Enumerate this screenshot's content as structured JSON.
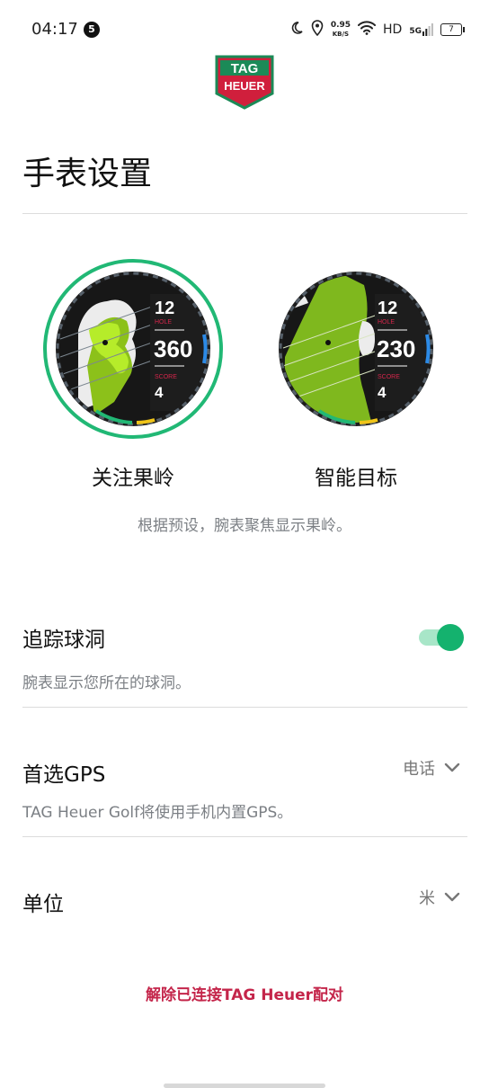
{
  "status_bar": {
    "time": "04:17",
    "notification_count": "5",
    "net_speed": "0.95",
    "net_unit": "KB/S",
    "hd": "HD",
    "network": "5G",
    "battery": "7"
  },
  "header": {
    "logo_line1": "TAG",
    "logo_line2": "HEUER",
    "title": "手表设置"
  },
  "watch_faces": [
    {
      "label": "关注果岭",
      "selected": true,
      "hole": "12",
      "hole_label": "HOLE",
      "distance": "360",
      "score_label": "SCORE",
      "score": "4"
    },
    {
      "label": "智能目标",
      "selected": false,
      "hole": "12",
      "hole_label": "HOLE",
      "distance": "230",
      "score_label": "SCORE",
      "score": "4"
    }
  ],
  "face_description": "根据预设，腕表聚焦显示果岭。",
  "settings": {
    "track_hole": {
      "title": "追踪球洞",
      "subtitle": "腕表显示您所在的球洞。",
      "enabled": true
    },
    "preferred_gps": {
      "title": "首选GPS",
      "value": "电话",
      "subtitle": "TAG Heuer Golf将使用手机内置GPS。"
    },
    "units": {
      "title": "单位",
      "value": "米"
    }
  },
  "unpair_label": "解除已连接TAG Heuer配对",
  "colors": {
    "accent_green": "#14b26e",
    "toggle_track": "#a8e6c8",
    "unpair_red": "#c4254a",
    "logo_red": "#d01f3c",
    "logo_green": "#1b8a57"
  }
}
